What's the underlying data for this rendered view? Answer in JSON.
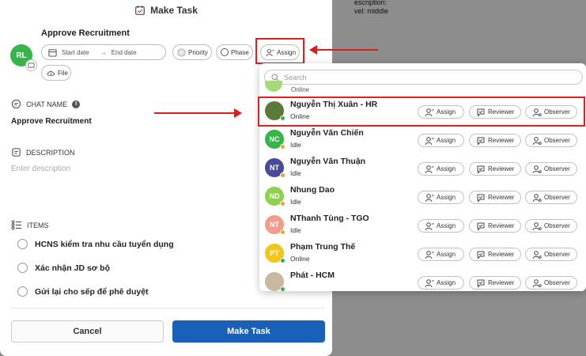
{
  "background": {
    "line1": "escription:",
    "line2": "vel: middle"
  },
  "modal": {
    "title": "Make Task",
    "avatar_initials": "RL",
    "task_title": "Approve Recruitment",
    "start_date_placeholder": "Start date",
    "end_date_placeholder": "End date",
    "priority_label": "Priority",
    "phase_label": "Phase",
    "assign_label": "Assign",
    "file_label": "File",
    "chat_name_label": "CHAT NAME",
    "chat_name_value": "Approve Recruitment",
    "description_label": "DESCRIPTION",
    "description_placeholder": "Enter description",
    "items_label": "ITEMS",
    "items": [
      "HCNS kiểm tra nhu cầu tuyển dụng",
      "Xác nhận JD sơ bộ",
      "Gửi lại cho sếp để phê duyệt"
    ],
    "cancel_label": "Cancel",
    "make_task_label": "Make Task"
  },
  "dropdown": {
    "search_placeholder": "Search",
    "partial_top_status": "Online",
    "assign_label": "Assign",
    "reviewer_label": "Reviewer",
    "observer_label": "Observer",
    "users": [
      {
        "name": "Nguyễn Thị Xuân - HR",
        "status": "Online",
        "initials": "",
        "color": "#5a7a3a",
        "status_color": "#35b54a"
      },
      {
        "name": "Nguyễn Văn Chiến",
        "status": "Idle",
        "initials": "NC",
        "color": "#35b54a",
        "status_color": "#f5a623"
      },
      {
        "name": "Nguyễn Văn Thuận",
        "status": "Idle",
        "initials": "NT",
        "color": "#4a4a9a",
        "status_color": "#f5a623"
      },
      {
        "name": "Nhung Dao",
        "status": "Idle",
        "initials": "ND",
        "color": "#8fd14f",
        "status_color": "#f5a623"
      },
      {
        "name": "NThanh Tùng - TGO",
        "status": "Idle",
        "initials": "NT",
        "color": "#f79a8a",
        "status_color": "#f5a623"
      },
      {
        "name": "Phạm Trung Thế",
        "status": "Online",
        "initials": "PT",
        "color": "#f5c518",
        "status_color": "#35b54a"
      },
      {
        "name": "Phát - HCM",
        "status": "",
        "initials": "",
        "color": "#c8b8a0",
        "status_color": "#35b54a"
      }
    ]
  }
}
